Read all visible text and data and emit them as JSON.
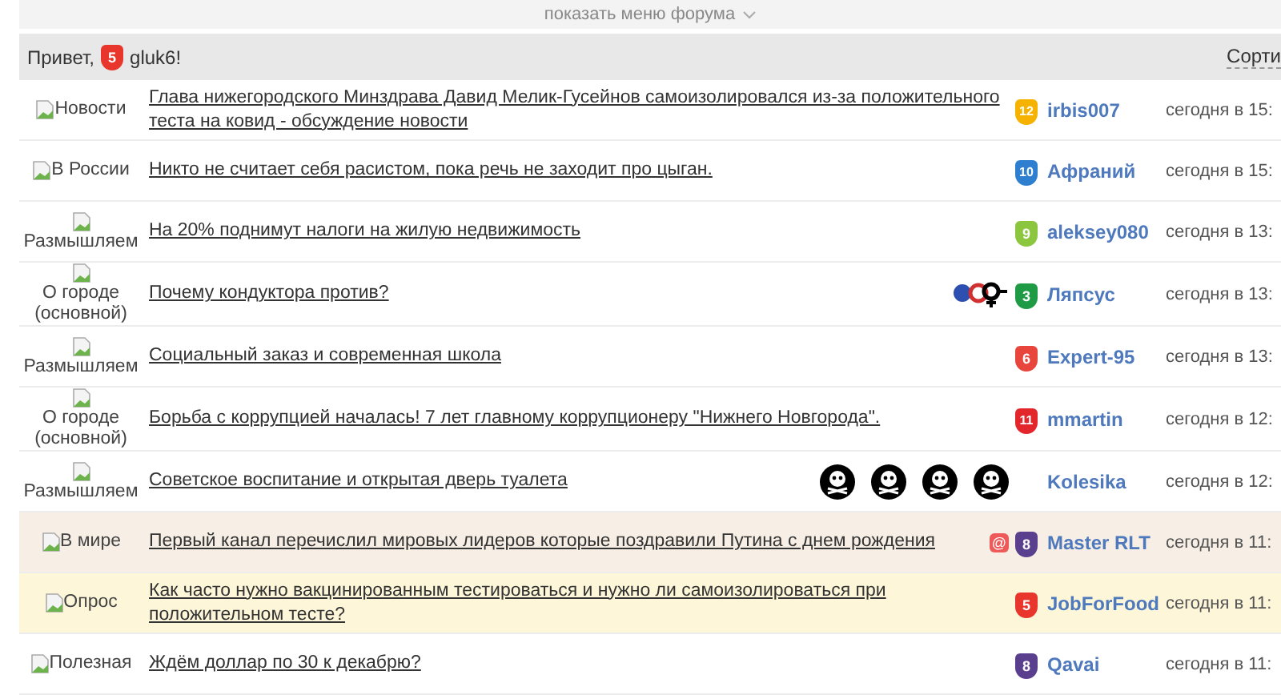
{
  "menu_toggle": {
    "label": "показать меню форума"
  },
  "header": {
    "greeting": "Привет,",
    "badge": {
      "label": "5",
      "color": "#e8362c"
    },
    "username": "gluk6!",
    "sort": "Сорти"
  },
  "topics": [
    {
      "category": "Новости",
      "title": "Глава нижегородского Минздрава Давид Мелик-Гусейнов самоизолировался из-за положительного теста на ковид - обсуждение новости",
      "badge": {
        "label": "12",
        "color": "#f5b300"
      },
      "author": "irbis007",
      "time": "сегодня в 15:",
      "kind": "plain"
    },
    {
      "category": "В России",
      "title": "Никто не считает себя расистом, пока речь не заходит про цыган.",
      "badge": {
        "label": "10",
        "color": "#2f7fd0"
      },
      "author": "Афраний",
      "time": "сегодня в 15:",
      "kind": "plain"
    },
    {
      "category": "Размышляем",
      "title": "На 20% поднимут налоги на жилую недвижимость",
      "badge": {
        "label": "9",
        "color": "#8cc63f"
      },
      "author": "aleksey080",
      "time": "сегодня в 13:",
      "kind": "plain"
    },
    {
      "category": "О городе (основной)",
      "title": "Почему кондуктора против?",
      "extras": [
        {
          "kind": "gender"
        }
      ],
      "badge": {
        "label": "3",
        "color": "#1f9a45"
      },
      "author": "Ляпсус",
      "time": "сегодня в 13:",
      "kind": "plain"
    },
    {
      "category": "Размышляем",
      "title": "Социальный заказ и современная школа",
      "badge": {
        "label": "6",
        "color": "#e8453c"
      },
      "author": "Expert-95",
      "time": "сегодня в 13:",
      "kind": "plain"
    },
    {
      "category": "О городе (основной)",
      "title": "Борьба с коррупцией началась! 7 лет главному коррупционеру \"Нижнего Новгорода\".",
      "badge": {
        "label": "11",
        "color": "#e3262b"
      },
      "author": "mmartin",
      "time": "сегодня в 12:",
      "kind": "plain"
    },
    {
      "category": "Размышляем",
      "title": "Советское воспитание и открытая дверь туалета",
      "extras": [
        {
          "kind": "skull"
        },
        {
          "kind": "skull"
        },
        {
          "kind": "skull"
        },
        {
          "kind": "skull"
        }
      ],
      "author": "Kolesika",
      "time": "сегодня в 12:",
      "kind": "plain"
    },
    {
      "category": "В мире",
      "title": "Первый канал перечислил мировых лидеров которые поздравили Путина с днем рождения",
      "extras": [
        {
          "kind": "at",
          "label": "@"
        }
      ],
      "badge": {
        "label": "8",
        "color": "#5b3f8f"
      },
      "author": "Master RLT",
      "time": "сегодня в 11:",
      "kind": "pinned"
    },
    {
      "category": "Опрос",
      "title": "Как часто нужно вакцинированным тестироваться и нужно ли самоизолироваться при положительном тесте?",
      "badge": {
        "label": "5",
        "color": "#e8362c"
      },
      "author": "JobForFood",
      "time": "сегодня в 11:",
      "kind": "poll"
    },
    {
      "category": "Полезная",
      "title": "Ждём доллар по 30 к декабрю?",
      "badge": {
        "label": "8",
        "color": "#5b3f8f"
      },
      "author": "Qavai",
      "time": "сегодня в 11:",
      "kind": "plain"
    }
  ]
}
